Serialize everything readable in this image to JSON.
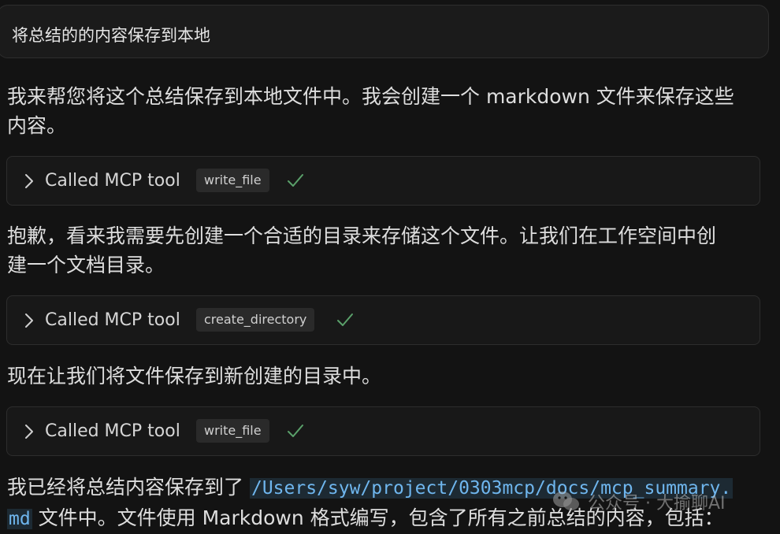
{
  "user_message": "将总结的的内容保存到本地",
  "messages": [
    {
      "line1": "我来帮您将这个总结保存到本地文件中。我会创建一个 markdown 文件来保存这些",
      "line2": "内容。"
    },
    {
      "line1": "抱歉，看来我需要先创建一个合适的目录来存储这个文件。让我们在工作空间中创",
      "line2": "建一个文档目录。"
    },
    {
      "line1": "现在让我们将文件保存到新创建的目录中。"
    },
    {
      "line1_prefix": "我已经将总结内容保存到了",
      "path_part1": "/Users/syw/project/0303mcp/docs/mcp_summary.",
      "path_part2": "md",
      "line2_suffix": "文件中。文件使用 Markdown 格式编写，包含了所有之前总结的内容，包括："
    }
  ],
  "tool_calls": [
    {
      "label": "Called MCP tool",
      "tool": "write_file",
      "status": "success"
    },
    {
      "label": "Called MCP tool",
      "tool": "create_directory",
      "status": "success"
    },
    {
      "label": "Called MCP tool",
      "tool": "write_file",
      "status": "success"
    }
  ],
  "watermark": "公众号 · 大揄聊AI",
  "colors": {
    "background": "#131313",
    "check": "#5aa06a",
    "path_text": "#6fb6ee"
  }
}
